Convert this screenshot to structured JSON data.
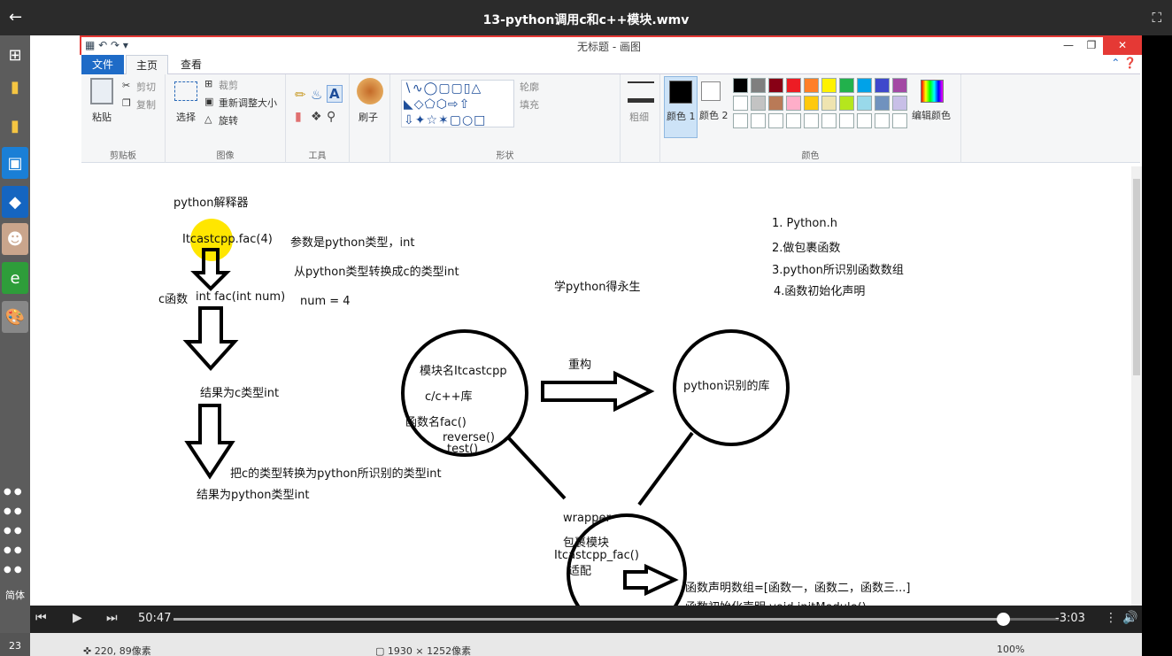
{
  "player": {
    "back_icon": "arrow-left-icon",
    "title": "13-python调用c和c++模块.wmv",
    "fullscreen_icon": "fullscreen-icon",
    "elapsed": "50:47",
    "remaining": "-3:03",
    "progress_fraction": 0.937
  },
  "taskbar": {
    "icons": [
      "windows-start-icon",
      "folder-icon",
      "folder-icon",
      "window-app-icon",
      "blue-app-icon",
      "avatar-icon",
      "ie-browser-icon",
      "paint-palette-icon"
    ],
    "lang": "简体",
    "date_fragment": "23"
  },
  "paint": {
    "window_title": "无标题 - 画图",
    "tabs": {
      "file": "文件",
      "home": "主页",
      "view": "查看"
    },
    "clipboard": {
      "paste": "粘贴",
      "cut": "剪切",
      "copy": "复制",
      "group": "剪贴板"
    },
    "image": {
      "select": "选择",
      "crop": "裁剪",
      "resize": "重新调整大小",
      "rotate": "旋转",
      "group": "图像"
    },
    "tools": {
      "group": "工具"
    },
    "brushes": {
      "label": "刷子"
    },
    "shapes": {
      "outline": "轮廓",
      "fill": "填充",
      "group": "形状"
    },
    "size": {
      "label": "粗细"
    },
    "colors": {
      "color1": "颜色 1",
      "color2": "颜色 2",
      "edit": "编辑颜色",
      "group": "颜色",
      "palette": [
        "#000000",
        "#7f7f7f",
        "#880015",
        "#ed1c24",
        "#ff7f27",
        "#fff200",
        "#22b14c",
        "#00a2e8",
        "#3f48cc",
        "#a349a4",
        "#ffffff",
        "#c3c3c3",
        "#b97a57",
        "#ffaec9",
        "#ffc90e",
        "#efe4b0",
        "#b5e61d",
        "#99d9ea",
        "#7092be",
        "#c8bfe7",
        "#ffffff",
        "#ffffff",
        "#ffffff",
        "#ffffff",
        "#ffffff",
        "#ffffff",
        "#ffffff",
        "#ffffff",
        "#ffffff",
        "#ffffff"
      ]
    },
    "status": {
      "cursor": "220, 89像素",
      "size": "1930 × 1252像素",
      "zoom": "100%"
    }
  },
  "canvas_text": {
    "interpreter": "python解释器",
    "call": "Itcastcpp.fac(4)",
    "param": "参数是python类型，int",
    "convert": "从python类型转换成c的类型int",
    "c_func_label": "c函数",
    "c_func": "int fac(int num)",
    "num": "num = 4",
    "result_c": "结果为c类型int",
    "convert_back": "把c的类型转换为python所识别的类型int",
    "result_py": "结果为python类型int",
    "motto": "学python得永生",
    "list1": "1. Python.h",
    "list2": "2.做包裹函数",
    "list3": "3.python所识别函数数组",
    "list4": "4.函数初始化声明",
    "module_name": "模块名Itcastcpp",
    "lib": "c/c++库",
    "func_name": "函数名fac()",
    "reverse": "reverse()",
    "test": "test()",
    "refactor": "重构",
    "py_lib": "python识别的库",
    "wrapper": "wrapper",
    "wrap_module": "包裹模块",
    "wrap_func": "Itcastcpp_fac()",
    "adapt": "适配",
    "decl_array": "函数声明数组=[函数一，函数二，函数三...]",
    "init_decl": "函数初始化声明 void initModule()"
  }
}
